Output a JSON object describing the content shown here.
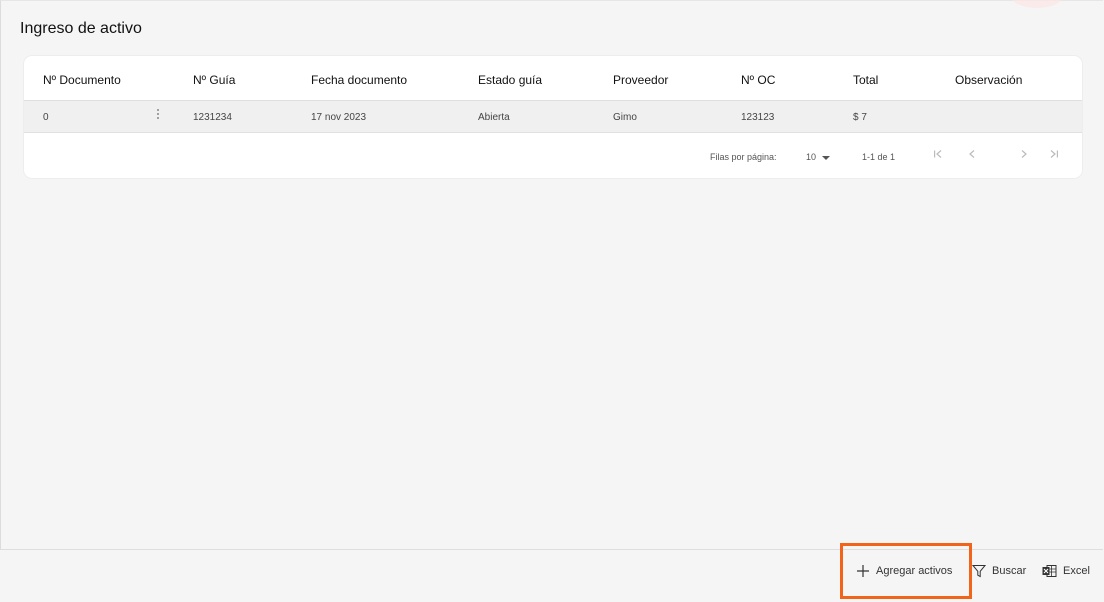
{
  "page": {
    "title": "Ingreso de activo"
  },
  "table": {
    "columns": [
      "Nº Documento",
      "Nº Guía",
      "Fecha documento",
      "Estado guía",
      "Proveedor",
      "Nº OC",
      "Total",
      "Observación"
    ],
    "rows": [
      {
        "documento": "0",
        "guia": "1231234",
        "fecha": "17 nov 2023",
        "estado": "Abierta",
        "proveedor": "Gimo",
        "oc": "123123",
        "total": "$ 7",
        "observacion": ""
      }
    ]
  },
  "pagination": {
    "rows_per_page_label": "Filas por página:",
    "rows_per_page_value": "10",
    "range_label": "1-1 de 1"
  },
  "actions": {
    "add_label": "Agregar activos",
    "search_label": "Buscar",
    "excel_label": "Excel"
  },
  "colors": {
    "highlight": "#f26419",
    "background": "#f5f5f5"
  },
  "icons": [
    "kebab-menu-icon",
    "first-page-icon",
    "prev-page-icon",
    "next-page-icon",
    "last-page-icon",
    "plus-icon",
    "filter-icon",
    "excel-icon"
  ]
}
